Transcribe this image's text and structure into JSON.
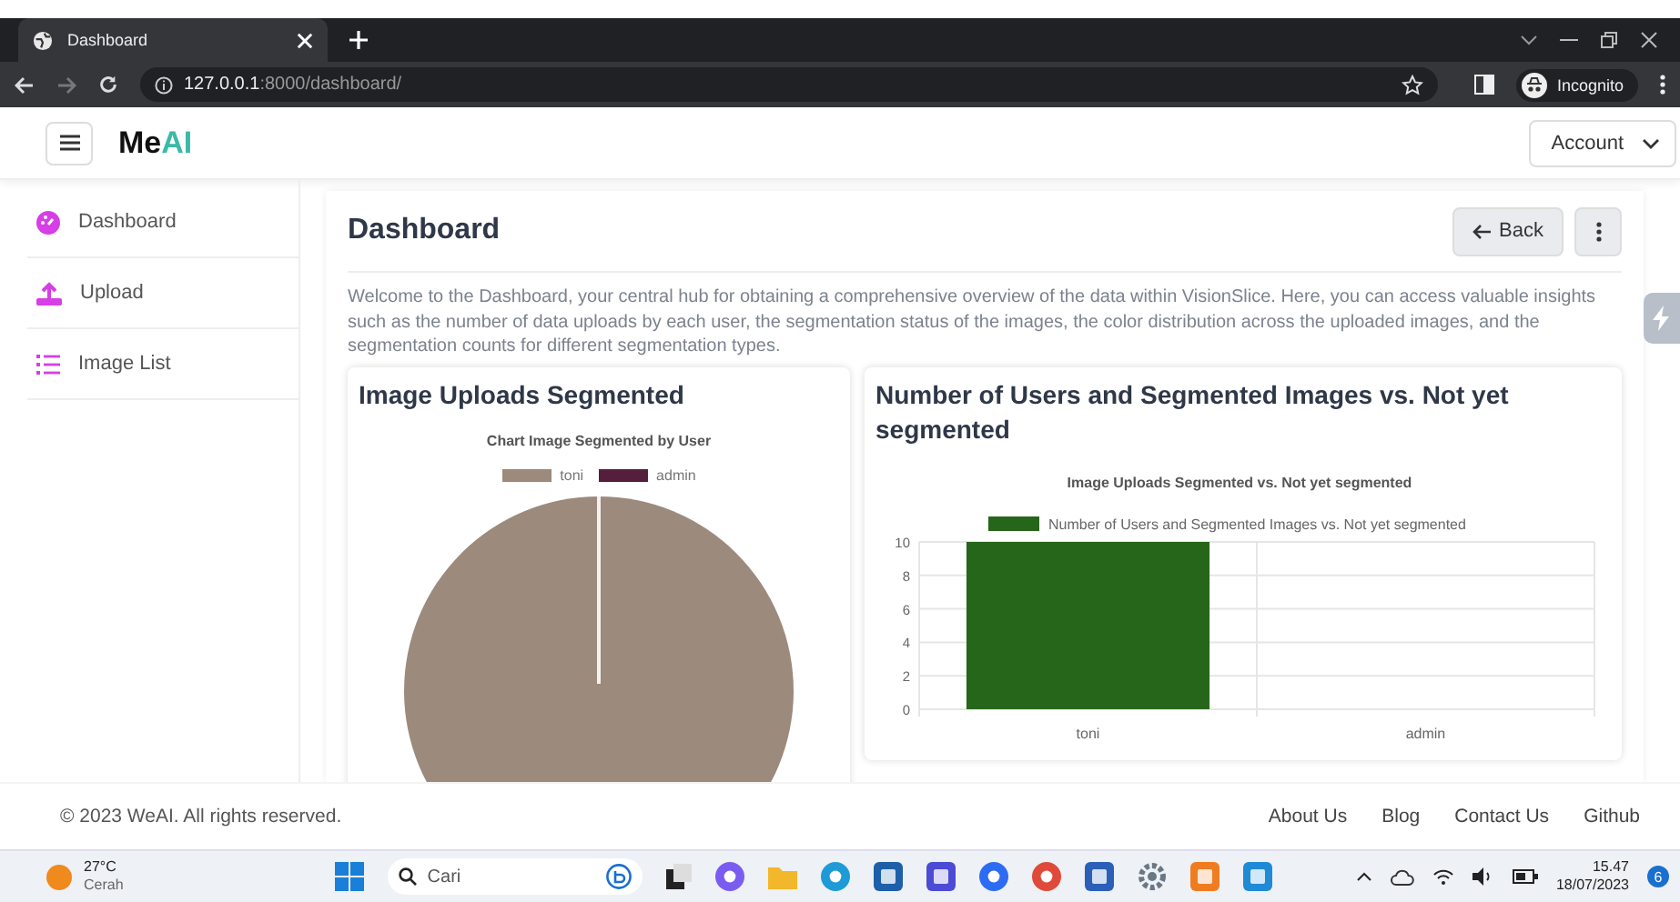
{
  "browser": {
    "tab_title": "Dashboard",
    "url_host": "127.0.0.1",
    "url_path": ":8000/dashboard/",
    "profile": "Incognito"
  },
  "navbar": {
    "brand_main": "Me",
    "brand_accent": "AI",
    "account": "Account"
  },
  "sidebar": {
    "items": [
      {
        "label": "Dashboard",
        "kind": "gauge"
      },
      {
        "label": "Upload",
        "kind": "upload"
      },
      {
        "label": "Image List",
        "kind": "list"
      }
    ]
  },
  "page": {
    "title": "Dashboard",
    "back": "Back",
    "intro": "Welcome to the Dashboard, your central hub for obtaining a comprehensive overview of the data within VisionSlice. Here, you can access valuable insights such as the number of data uploads by each user, the segmentation status of the images, the color distribution across the uploaded images, and the segmentation counts for different segmentation types."
  },
  "cards": [
    {
      "title": "Image Uploads Segmented",
      "pie": {
        "title": "Chart Image Segmented by User",
        "legend": [
          {
            "label": "toni",
            "color": "#9c8a7c"
          },
          {
            "label": "admin",
            "color": "#561e3d"
          }
        ]
      }
    },
    {
      "title": "Number of Users and Segmented Images vs. Not yet segmented",
      "chart_data": {
        "type": "bar",
        "title": "Image Uploads Segmented vs. Not yet segmented",
        "categories": [
          "toni",
          "admin"
        ],
        "series": [
          {
            "name": "Number of Users and Segmented Images vs. Not yet segmented",
            "color": "#26661a",
            "values": [
              10,
              0
            ]
          }
        ],
        "ylim": [
          0,
          10
        ],
        "yticks": [
          0,
          2,
          4,
          6,
          8,
          10
        ],
        "grid": true
      }
    }
  ],
  "footer": {
    "copyright": "© 2023 WeAI. All rights reserved.",
    "links": [
      "About Us",
      "Blog",
      "Contact Us",
      "Github"
    ]
  },
  "taskbar": {
    "temperature": "27°C",
    "weather": "Cerah",
    "search": "Cari",
    "apps": [
      {
        "kind": "chat"
      },
      {
        "kind": "folder"
      },
      {
        "kind": "edge"
      },
      {
        "kind": "store"
      },
      {
        "kind": "pen"
      },
      {
        "kind": "zoom"
      },
      {
        "kind": "chrome"
      },
      {
        "kind": "word"
      },
      {
        "kind": "gear"
      },
      {
        "kind": "xampp"
      },
      {
        "kind": "vscode"
      }
    ],
    "time": "15.47",
    "date": "18/07/2023",
    "notifications": "6"
  }
}
